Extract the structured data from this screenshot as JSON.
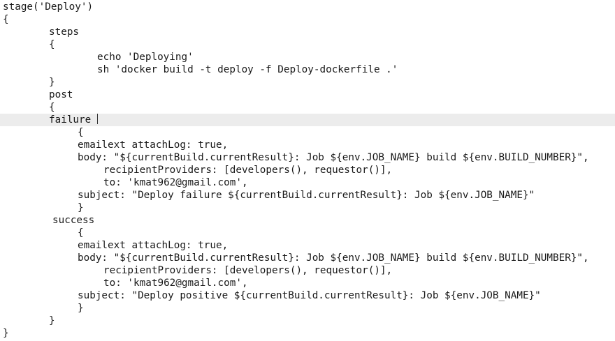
{
  "editor": {
    "lines": [
      "stage('Deploy')",
      "{",
      "steps",
      "{",
      "echo 'Deploying'",
      "sh 'docker build -t deploy -f Deploy-dockerfile .'",
      "}",
      "post",
      "{",
      "failure",
      "{",
      "emailext attachLog: true,",
      "body: \"${currentBuild.currentResult}: Job ${env.JOB_NAME} build ${env.BUILD_NUMBER}\",",
      "recipientProviders: [developers(), requestor()],",
      "to: 'kmat962@gmail.com',",
      "subject: \"Deploy failure ${currentBuild.currentResult}: Job ${env.JOB_NAME}\"",
      "}",
      "success",
      "{",
      "emailext attachLog: true,",
      "body: \"${currentBuild.currentResult}: Job ${env.JOB_NAME} build ${env.BUILD_NUMBER}\",",
      "recipientProviders: [developers(), requestor()],",
      "to: 'kmat962@gmail.com',",
      "subject: \"Deploy positive ${currentBuild.currentResult}: Job ${env.JOB_NAME}\"",
      "}",
      "}",
      "}"
    ],
    "current_line_index": 9,
    "colors": {
      "background": "#ffffff",
      "text": "#1a1a1a",
      "current_line_highlight": "#ececec"
    }
  }
}
